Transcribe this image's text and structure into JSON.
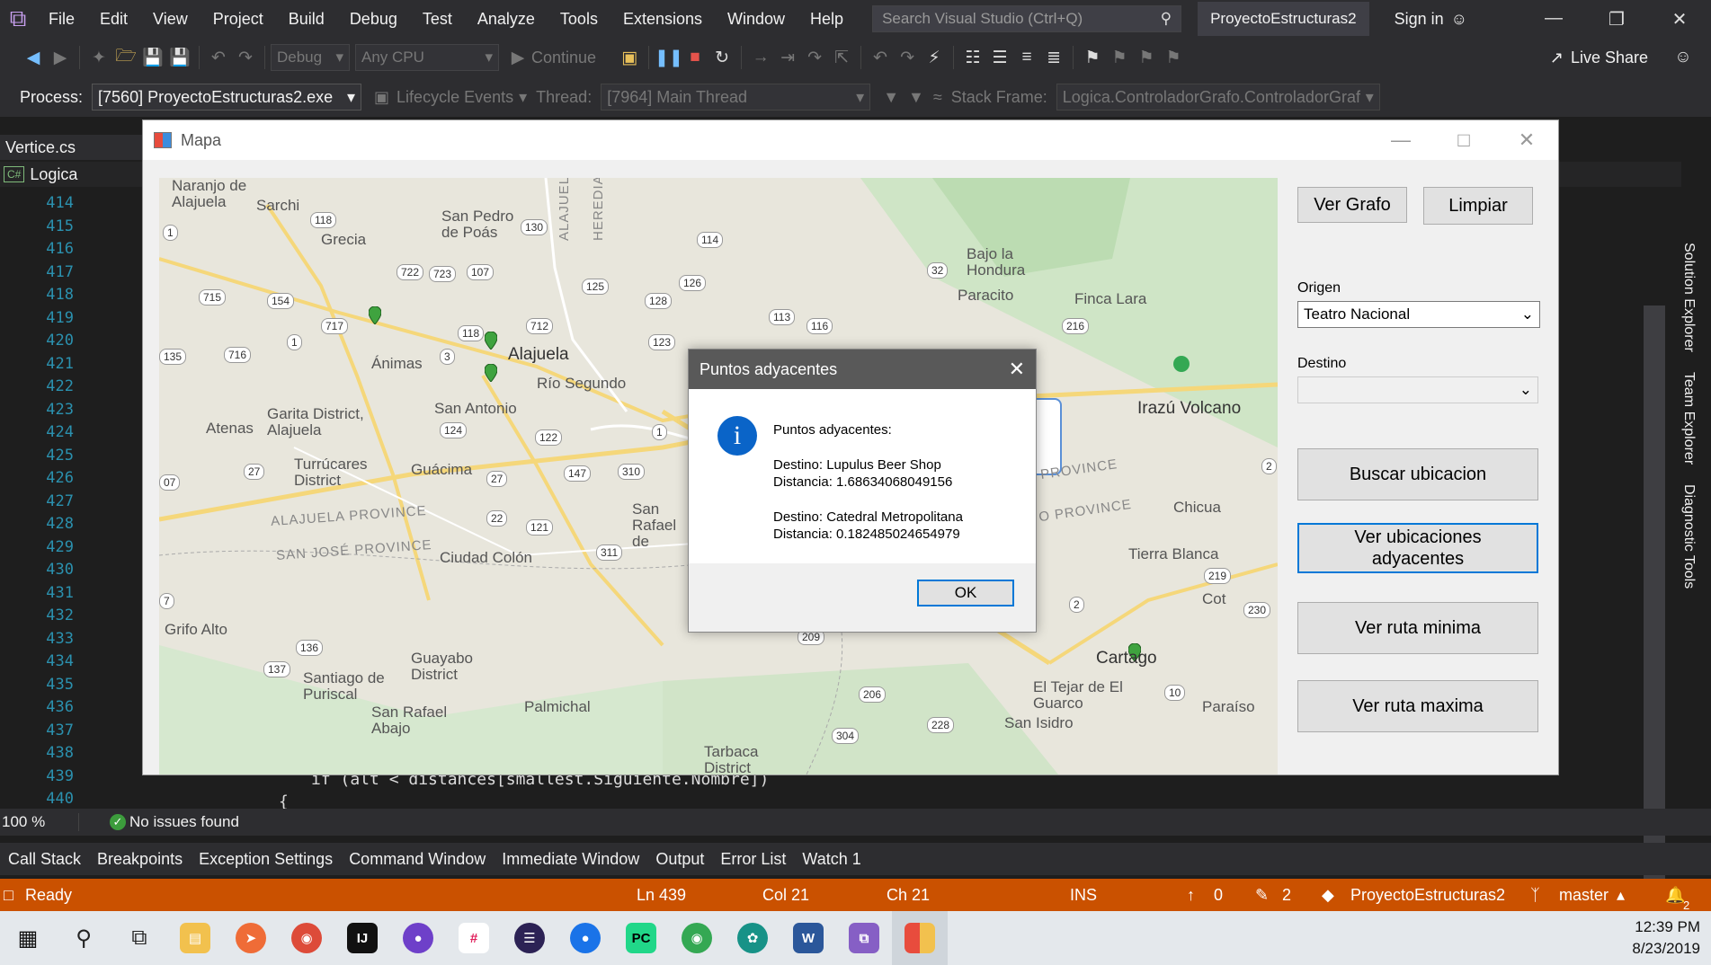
{
  "menu": {
    "items": [
      "File",
      "Edit",
      "View",
      "Project",
      "Build",
      "Debug",
      "Test",
      "Analyze",
      "Tools",
      "Extensions",
      "Window",
      "Help"
    ],
    "search_placeholder": "Search Visual Studio (Ctrl+Q)",
    "project_name": "ProyectoEstructuras2",
    "sign_in": "Sign in"
  },
  "toolbar": {
    "config": "Debug",
    "platform": "Any CPU",
    "continue_label": "Continue",
    "live_share": "Live Share"
  },
  "process_bar": {
    "process_label": "Process:",
    "process_value": "[7560] ProyectoEstructuras2.exe",
    "lifecycle": "Lifecycle Events",
    "thread_label": "Thread:",
    "thread_value": "[7964] Main Thread",
    "stack_label": "Stack Frame:",
    "stack_value": "Logica.ControladorGrafo.ControladorGraf"
  },
  "editor": {
    "tab": "Vertice.cs",
    "nav_project": "Logica",
    "nav_badge": "C#",
    "line_numbers": [
      "414",
      "415",
      "416",
      "417",
      "418",
      "419",
      "420",
      "421",
      "422",
      "423",
      "424",
      "425",
      "426",
      "427",
      "428",
      "429",
      "430",
      "431",
      "432",
      "433",
      "434",
      "435",
      "436",
      "437",
      "438",
      "439",
      "440"
    ],
    "code_439": "if (alt < distances[smallest.Siguiente.Nombre])",
    "code_440": "{",
    "right_tabs": [
      "Solution Explorer",
      "Team Explorer",
      "Diagnostic Tools"
    ],
    "zoom": "100 %",
    "issues": "No issues found"
  },
  "tool_tabs": [
    "Call Stack",
    "Breakpoints",
    "Exception Settings",
    "Command Window",
    "Immediate Window",
    "Output",
    "Error List",
    "Watch 1"
  ],
  "statusbar": {
    "ready": "Ready",
    "ln": "Ln 439",
    "col": "Col 21",
    "ch": "Ch 21",
    "ins": "INS",
    "up_count": "0",
    "pencil_count": "2",
    "repo": "ProyectoEstructuras2",
    "branch": "master",
    "notif": "2"
  },
  "taskbar": {
    "time": "12:39 PM",
    "date": "8/23/2019"
  },
  "mapa": {
    "title": "Mapa",
    "buttons": {
      "ver_grafo": "Ver Grafo",
      "limpiar": "Limpiar",
      "buscar": "Buscar ubicacion",
      "adyacentes": "Ver ubicaciones adyacentes",
      "ruta_minima": "Ver ruta minima",
      "ruta_maxima": "Ver ruta maxima"
    },
    "origen_label": "Origen",
    "origen_value": "Teatro Nacional",
    "destino_label": "Destino",
    "destino_value": ""
  },
  "map_labels": {
    "naranjo": "Naranjo de Alajuela",
    "sarchi": "Sarchi",
    "grecia": "Grecia",
    "san_pedro": "San Pedro de Poás",
    "alajuela": "Alajuela",
    "animas": "Ánimas",
    "rio_segundo": "Río Segundo",
    "san_antonio": "San Antonio",
    "garita": "Garita District, Alajuela",
    "atenas": "Atenas",
    "turrucares": "Turrúcares District",
    "guacima": "Guácima",
    "alajuela_prov": "ALAJUELA PROVINCE",
    "sanjose_prov": "SAN JOSÉ PROVINCE",
    "ciudad_colon": "Ciudad Colón",
    "san_rafael_esc": "San Rafael de Escazú",
    "grifo_alto": "Grifo Alto",
    "santiago": "Santiago de Puriscal",
    "guayabo": "Guayabo District",
    "san_rafael_abajo": "San Rafael Abajo",
    "palmichal": "Palmichal",
    "tarbaca": "Tarbaca District",
    "bajo_honduras": "Bajo la Hondura",
    "paracito": "Paracito",
    "finca_lara": "Finca Lara",
    "irazu": "Irazú Volcano",
    "chicua": "Chicua",
    "tierra_blanca": "Tierra Blanca",
    "cot": "Cot",
    "cartago": "Cartago",
    "el_tejar": "El Tejar de El Guarco",
    "paraiso": "Paraíso",
    "san_isidro": "San Isidro",
    "alajuela_prov_v": "ALAJUELA PROV",
    "heredia_prov_v": "HEREDIA PROVI",
    "prov_right1": "PROVINCE",
    "prov_right2": "O PROVINCE"
  },
  "routes": [
    "1",
    "118",
    "130",
    "114",
    "722",
    "723",
    "107",
    "125",
    "126",
    "32",
    "715",
    "154",
    "128",
    "712",
    "113",
    "116",
    "717",
    "1",
    "118",
    "123",
    "216",
    "135",
    "716",
    "3",
    "124",
    "122",
    "1",
    "27",
    "27",
    "147",
    "310",
    "22",
    "121",
    "311",
    "136",
    "137",
    "206",
    "228",
    "304",
    "209",
    "219",
    "2",
    "230",
    "10",
    "2",
    "07",
    "7"
  ],
  "dialog": {
    "title": "Puntos adyacentes",
    "heading": "Puntos adyacentes:",
    "dest1": "Destino: Lupulus Beer Shop",
    "dist1": "Distancia: 1.68634068049156",
    "dest2": "Destino: Catedral Metropolitana",
    "dist2": "Distancia: 0.182485024654979",
    "ok": "OK"
  }
}
